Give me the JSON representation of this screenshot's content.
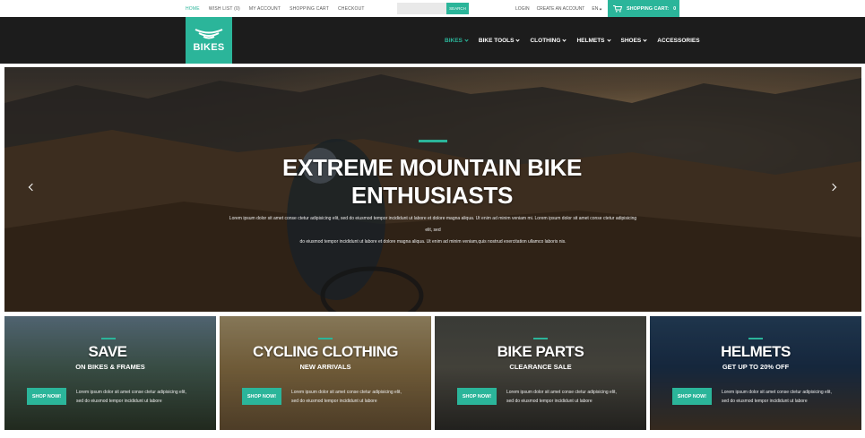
{
  "topbar": {
    "links": [
      "HOME",
      "WISH LIST (0)",
      "MY ACCOUNT",
      "SHOPPING CART",
      "CHECKOUT"
    ],
    "search": {
      "placeholder": "",
      "button": "SEARCH"
    },
    "login": "LOGIN",
    "create_account": "CREATE AN ACCOUNT",
    "language": "EN",
    "currency": "$",
    "cart_label": "SHOPPING CART:",
    "cart_count": "0"
  },
  "header": {
    "logo": "BIKES",
    "nav": [
      {
        "label": "BIKES",
        "dropdown": true
      },
      {
        "label": "BIKE TOOLS",
        "dropdown": true
      },
      {
        "label": "CLOTHING",
        "dropdown": true
      },
      {
        "label": "HELMETS",
        "dropdown": true
      },
      {
        "label": "SHOES",
        "dropdown": true
      },
      {
        "label": "ACCESSORIES",
        "dropdown": false
      }
    ]
  },
  "hero": {
    "title_line1": "EXTREME MOUNTAIN BIKE",
    "title_line2": "ENTHUSIASTS",
    "desc_line1": "Lorem ipsum dolor sit amet conse ctetur adipisicing elit, sed do eiusmod tempor incididunt ut labore et dolore magna aliqua. Ut enim ad minim veniam mi. Lorem ipsum dolor sit amet conse ctetur adipisicing elit, sed",
    "desc_line2": "do eiusmod tempor incididunt ut labore et dolore magna aliqua. Ut enim ad minim veniam,quis nostrud exercitation ullamco laboris nis."
  },
  "banners": [
    {
      "title": "SAVE",
      "subtitle": "ON BIKES & FRAMES",
      "button": "SHOP NOW!",
      "desc_line1": "Lorem ipsum dolor sit amet conse ctetur adipisicing elit,",
      "desc_line2": "sed do eiusmod tempor incididunt ut labore"
    },
    {
      "title": "CYCLING CLOTHING",
      "subtitle": "NEW ARRIVALS",
      "button": "SHOP NOW!",
      "desc_line1": "Lorem ipsum dolor sit amet conse ctetur adipisicing elit,",
      "desc_line2": "sed do eiusmod tempor incididunt ut labore"
    },
    {
      "title": "BIKE PARTS",
      "subtitle": "CLEARANCE SALE",
      "button": "SHOP NOW!",
      "desc_line1": "Lorem ipsum dolor sit amet conse ctetur adipisicing elit,",
      "desc_line2": "sed do eiusmod tempor incididunt ut labore"
    },
    {
      "title": "HELMETS",
      "subtitle": "GET UP TO 20% OFF",
      "button": "SHOP NOW!",
      "desc_line1": "Lorem ipsum dolor sit amet conse ctetur adipisicing elit,",
      "desc_line2": "sed do eiusmod tempor incididunt ut labore"
    }
  ],
  "colors": {
    "accent": "#2bb59a",
    "header_bg": "#1c1c1c"
  },
  "icons": [
    "shopping-cart-icon",
    "bike-logo-icon",
    "chevron-down-icon",
    "arrow-left-icon",
    "arrow-right-icon"
  ]
}
